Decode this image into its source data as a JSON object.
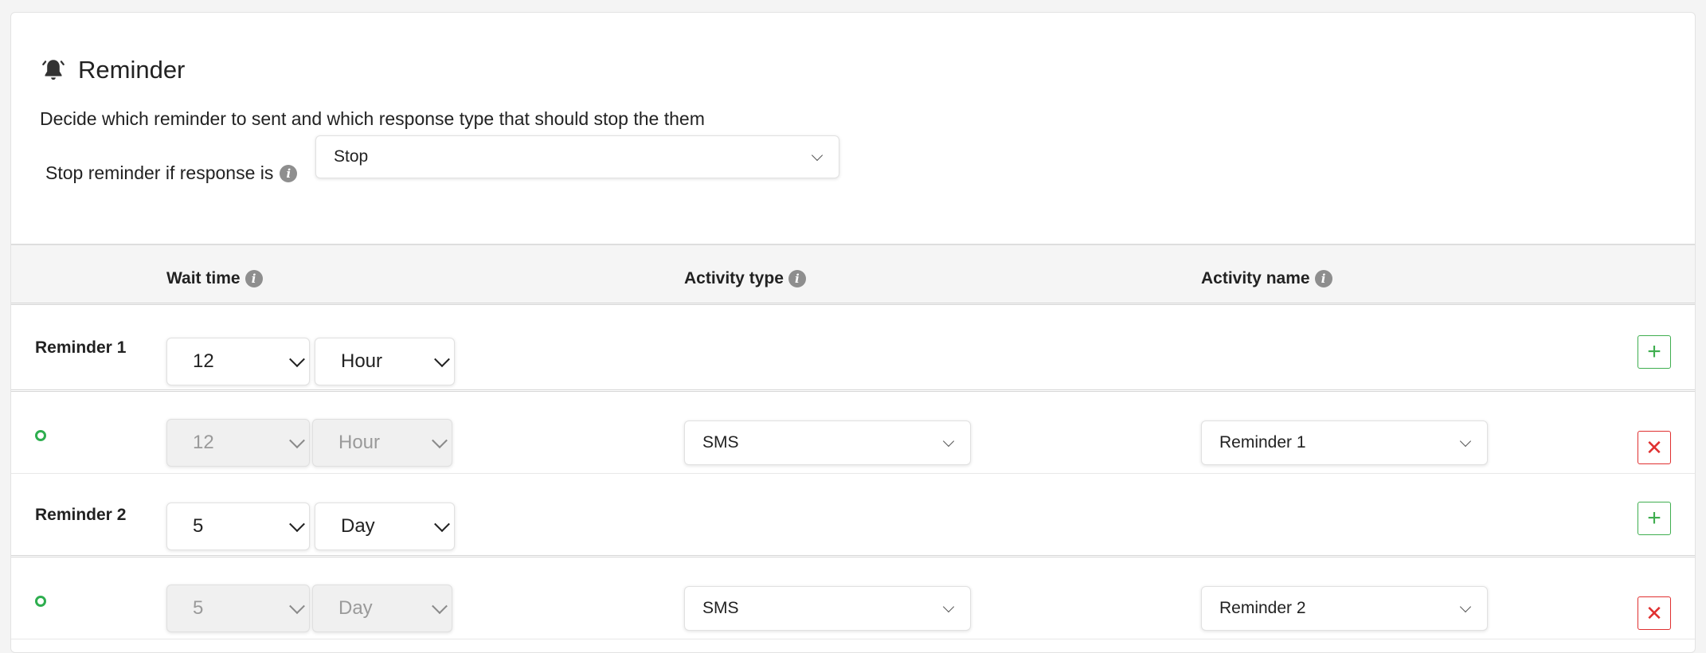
{
  "header": {
    "title": "Reminder",
    "description": "Decide which reminder to sent and which response type that should stop the them"
  },
  "stop": {
    "label": "Stop reminder if response is",
    "value": "Stop"
  },
  "table": {
    "headers": {
      "wait_time": "Wait time",
      "activity_type": "Activity type",
      "activity_name": "Activity name"
    }
  },
  "reminders": [
    {
      "label": "Reminder 1",
      "wait_value": "12",
      "wait_unit": "Hour",
      "detail": {
        "wait_value": "12",
        "wait_unit": "Hour",
        "activity_type": "SMS",
        "activity_name": "Reminder 1"
      }
    },
    {
      "label": "Reminder 2",
      "wait_value": "5",
      "wait_unit": "Day",
      "detail": {
        "wait_value": "5",
        "wait_unit": "Day",
        "activity_type": "SMS",
        "activity_name": "Reminder 2"
      }
    }
  ],
  "buttons": {
    "add_symbol": "+",
    "delete_symbol": "✕"
  },
  "colors": {
    "add": "#3fae4f",
    "delete": "#e03030",
    "status_dot": "#2eae4f"
  }
}
